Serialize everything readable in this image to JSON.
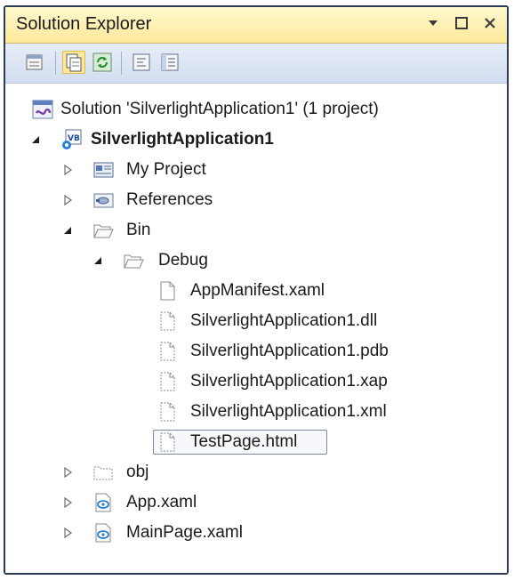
{
  "window": {
    "title": "Solution Explorer",
    "controls": [
      "dropdown",
      "maximize",
      "close"
    ]
  },
  "toolbar": {
    "buttons": [
      {
        "icon": "properties-icon",
        "active": false
      },
      {
        "icon": "show-all-files-icon",
        "active": true
      },
      {
        "icon": "refresh-icon",
        "active": false
      },
      {
        "icon": "view-code-icon",
        "active": false
      },
      {
        "icon": "view-designer-icon",
        "active": false
      }
    ]
  },
  "tree": {
    "solution": "Solution 'SilverlightApplication1' (1 project)",
    "project": "SilverlightApplication1",
    "items": {
      "my_project": "My Project",
      "references": "References",
      "bin": "Bin",
      "debug": "Debug",
      "file1": "AppManifest.xaml",
      "file2": "SilverlightApplication1.dll",
      "file3": "SilverlightApplication1.pdb",
      "file4": "SilverlightApplication1.xap",
      "file5": "SilverlightApplication1.xml",
      "file6": "TestPage.html",
      "obj": "obj",
      "app_xaml": "App.xaml",
      "mainpage_xaml": "MainPage.xaml"
    },
    "selected": "TestPage.html"
  },
  "colors": {
    "frame": "#2b3a55",
    "titlebar": "#ffe89a",
    "toolbar": "#d2ddef",
    "active_button": "#ffe99d"
  }
}
